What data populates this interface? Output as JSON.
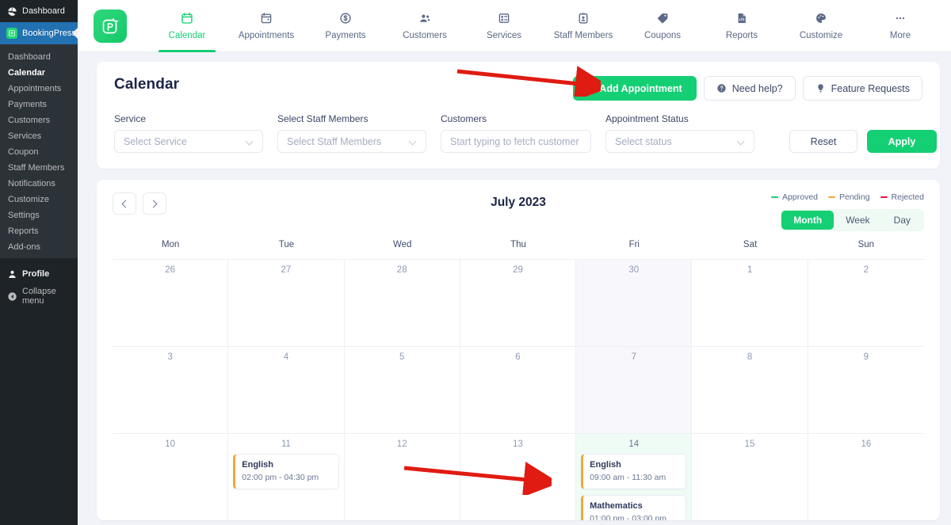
{
  "wp_sidebar": {
    "top_items": [
      {
        "label": "Dashboard",
        "icon": "dashboard-icon",
        "active": false
      },
      {
        "label": "BookingPress",
        "icon": "bookingpress-logo-icon",
        "active": true
      }
    ],
    "submenu": [
      {
        "label": "Dashboard",
        "current": false
      },
      {
        "label": "Calendar",
        "current": true
      },
      {
        "label": "Appointments",
        "current": false
      },
      {
        "label": "Payments",
        "current": false
      },
      {
        "label": "Customers",
        "current": false
      },
      {
        "label": "Services",
        "current": false
      },
      {
        "label": "Coupon",
        "current": false
      },
      {
        "label": "Staff Members",
        "current": false
      },
      {
        "label": "Notifications",
        "current": false
      },
      {
        "label": "Customize",
        "current": false
      },
      {
        "label": "Settings",
        "current": false
      },
      {
        "label": "Reports",
        "current": false
      },
      {
        "label": "Add-ons",
        "current": false
      }
    ],
    "bottom_items": [
      {
        "label": "Profile",
        "icon": "user-icon"
      },
      {
        "label": "Collapse menu",
        "icon": "collapse-icon"
      }
    ]
  },
  "topnav": {
    "logo_icon": "bookingpress-logo-icon",
    "items": [
      {
        "label": "Calendar",
        "icon": "calendar-icon",
        "active": true
      },
      {
        "label": "Appointments",
        "icon": "appointments-icon",
        "active": false
      },
      {
        "label": "Payments",
        "icon": "dollar-icon",
        "active": false
      },
      {
        "label": "Customers",
        "icon": "customers-icon",
        "active": false
      },
      {
        "label": "Services",
        "icon": "services-icon",
        "active": false
      },
      {
        "label": "Staff Members",
        "icon": "staff-icon",
        "active": false
      },
      {
        "label": "Coupons",
        "icon": "tag-icon",
        "active": false
      },
      {
        "label": "Reports",
        "icon": "report-icon",
        "active": false
      },
      {
        "label": "Customize",
        "icon": "palette-icon",
        "active": false
      },
      {
        "label": "More",
        "icon": "ellipsis-icon",
        "active": false
      }
    ]
  },
  "header": {
    "title": "Calendar",
    "add_appointment_label": "Add Appointment",
    "need_help_label": "Need help?",
    "feature_requests_label": "Feature Requests"
  },
  "filters": {
    "service": {
      "label": "Service",
      "placeholder": "Select Service",
      "value": ""
    },
    "staff": {
      "label": "Select Staff Members",
      "placeholder": "Select Staff Members",
      "value": ""
    },
    "customers": {
      "label": "Customers",
      "placeholder": "Start typing to fetch customer",
      "value": ""
    },
    "status": {
      "label": "Appointment Status",
      "placeholder": "Select status",
      "value": ""
    },
    "reset_label": "Reset",
    "apply_label": "Apply"
  },
  "calendar": {
    "title": "July 2023",
    "legend": [
      {
        "label": "Approved",
        "color": "#15cf74"
      },
      {
        "label": "Pending",
        "color": "#f0a93b"
      },
      {
        "label": "Rejected",
        "color": "#e0193d"
      }
    ],
    "views": [
      {
        "label": "Month",
        "active": true
      },
      {
        "label": "Week",
        "active": false
      },
      {
        "label": "Day",
        "active": false
      }
    ],
    "day_headers": [
      "Mon",
      "Tue",
      "Wed",
      "Thu",
      "Fri",
      "Sat",
      "Sun"
    ],
    "weeks": [
      {
        "days": [
          {
            "num": "26",
            "other_month": true,
            "today": false,
            "friday": false,
            "events": []
          },
          {
            "num": "27",
            "other_month": true,
            "today": false,
            "friday": false,
            "events": []
          },
          {
            "num": "28",
            "other_month": true,
            "today": false,
            "friday": false,
            "events": []
          },
          {
            "num": "29",
            "other_month": true,
            "today": false,
            "friday": false,
            "events": []
          },
          {
            "num": "30",
            "other_month": true,
            "today": false,
            "friday": true,
            "events": []
          },
          {
            "num": "1",
            "other_month": false,
            "today": false,
            "friday": false,
            "events": []
          },
          {
            "num": "2",
            "other_month": false,
            "today": false,
            "friday": false,
            "events": []
          }
        ]
      },
      {
        "days": [
          {
            "num": "3",
            "other_month": false,
            "today": false,
            "friday": false,
            "events": []
          },
          {
            "num": "4",
            "other_month": false,
            "today": false,
            "friday": false,
            "events": []
          },
          {
            "num": "5",
            "other_month": false,
            "today": false,
            "friday": false,
            "events": []
          },
          {
            "num": "6",
            "other_month": false,
            "today": false,
            "friday": false,
            "events": []
          },
          {
            "num": "7",
            "other_month": false,
            "today": false,
            "friday": true,
            "events": []
          },
          {
            "num": "8",
            "other_month": false,
            "today": false,
            "friday": false,
            "events": []
          },
          {
            "num": "9",
            "other_month": false,
            "today": false,
            "friday": false,
            "events": []
          }
        ]
      },
      {
        "days": [
          {
            "num": "10",
            "other_month": false,
            "today": false,
            "friday": false,
            "events": []
          },
          {
            "num": "11",
            "other_month": false,
            "today": false,
            "friday": false,
            "events": [
              {
                "title": "English",
                "time": "02:00 pm - 04:30 pm",
                "status_color": "#f0a93b"
              }
            ]
          },
          {
            "num": "12",
            "other_month": false,
            "today": false,
            "friday": false,
            "events": []
          },
          {
            "num": "13",
            "other_month": false,
            "today": false,
            "friday": false,
            "events": []
          },
          {
            "num": "14",
            "other_month": false,
            "today": true,
            "friday": true,
            "events": [
              {
                "title": "English",
                "time": "09:00 am - 11:30 am",
                "status_color": "#f0a93b"
              },
              {
                "title": "Mathematics",
                "time": "01:00 pm - 03:00 pm",
                "status_color": "#f0a93b"
              }
            ]
          },
          {
            "num": "15",
            "other_month": false,
            "today": false,
            "friday": false,
            "events": []
          },
          {
            "num": "16",
            "other_month": false,
            "today": false,
            "friday": false,
            "events": []
          }
        ]
      }
    ]
  },
  "annotations": {
    "arrow_color": "#e01b12",
    "arrows": [
      {
        "name": "arrow-to-add-appointment"
      },
      {
        "name": "arrow-to-calendar-event"
      }
    ]
  }
}
